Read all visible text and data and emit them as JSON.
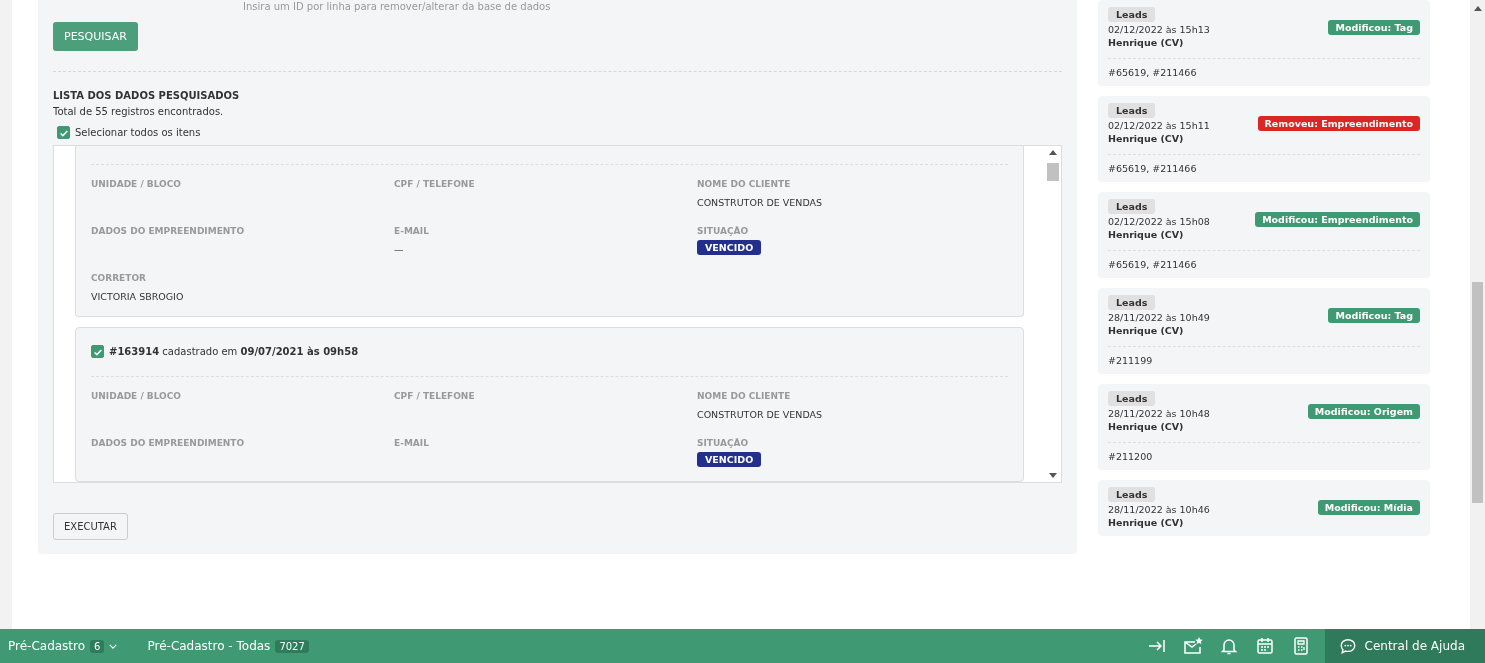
{
  "hint": "Insira um ID por linha para remover/alterar da base de dados",
  "search_button": "PESQUISAR",
  "results": {
    "title": "LISTA DOS DADOS PESQUISADOS",
    "total": "Total de 55 registros encontrados.",
    "select_all": {
      "label": "Selecionar todos os itens",
      "checked": true
    }
  },
  "records": [
    {
      "fields": [
        {
          "label": "UNIDADE / BLOCO"
        },
        {
          "label": "CPF / TELEFONE"
        },
        {
          "label": "NOME DO CLIENTE",
          "value": "CONSTRUTOR DE VENDAS"
        },
        {
          "label": "DADOS DO EMPREENDIMENTO"
        },
        {
          "label": "E-MAIL",
          "value": "—"
        },
        {
          "label": "SITUAÇÃO",
          "badge": "VENCIDO"
        },
        {
          "label": "CORRETOR",
          "value": "VICTORIA SBROGIO"
        }
      ]
    },
    {
      "header": {
        "checked": true,
        "text": "**#163914** cadastrado em **09/07/2021 às 09h58**"
      },
      "fields": [
        {
          "label": "UNIDADE / BLOCO"
        },
        {
          "label": "CPF / TELEFONE"
        },
        {
          "label": "NOME DO CLIENTE",
          "value": "CONSTRUTOR DE VENDAS"
        },
        {
          "label": "DADOS DO EMPREENDIMENTO"
        },
        {
          "label": "E-MAIL"
        },
        {
          "label": "SITUAÇÃO",
          "badge": "VENCIDO"
        }
      ]
    }
  ],
  "execute_button": "EXECUTAR",
  "history": [
    {
      "tag": "Leads",
      "date": "02/12/2022 às 15h13",
      "user": "Henrique (CV)",
      "action": "Modificou: Tag",
      "kind": "modified",
      "ids": "#65619, #211466"
    },
    {
      "tag": "Leads",
      "date": "02/12/2022 às 15h11",
      "user": "Henrique (CV)",
      "action": "Removeu: Empreendimento",
      "kind": "removed",
      "ids": "#65619, #211466"
    },
    {
      "tag": "Leads",
      "date": "02/12/2022 às 15h08",
      "user": "Henrique (CV)",
      "action": "Modificou: Empreendimento",
      "kind": "modified",
      "ids": "#65619, #211466"
    },
    {
      "tag": "Leads",
      "date": "28/11/2022 às 10h49",
      "user": "Henrique (CV)",
      "action": "Modificou: Tag",
      "kind": "modified",
      "ids": "#211199"
    },
    {
      "tag": "Leads",
      "date": "28/11/2022 às 10h48",
      "user": "Henrique (CV)",
      "action": "Modificou: Origem",
      "kind": "modified",
      "ids": "#211200"
    },
    {
      "tag": "Leads",
      "date": "28/11/2022 às 10h46",
      "user": "Henrique (CV)",
      "action": "Modificou: Mídia",
      "kind": "modified"
    }
  ],
  "bottom_bar": {
    "tabs": [
      {
        "label": "Pré-Cadastro",
        "count": "6",
        "has_menu": true
      },
      {
        "label": "Pré-Cadastro - Todas",
        "count": "7027",
        "has_menu": false
      }
    ],
    "help": "Central de Ajuda"
  }
}
